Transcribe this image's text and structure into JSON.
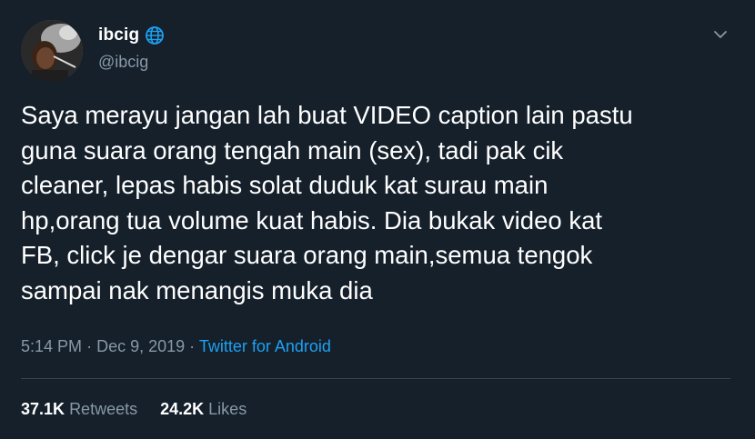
{
  "user": {
    "display_name": "ibcig",
    "handle": "@ibcig",
    "badge_icon": "globe-icon"
  },
  "tweet": {
    "text": "Saya merayu jangan lah buat VIDEO caption lain pastu\nguna suara orang tengah main (sex), tadi pak cik\ncleaner, lepas habis solat duduk kat surau main\nhp,orang tua volume kuat habis. Dia bukak video kat\nFB, click je dengar suara orang main,semua tengok\nsampai nak menangis muka dia",
    "time": "5:14 PM",
    "date": "Dec 9, 2019",
    "separator": "·",
    "source": "Twitter for Android"
  },
  "stats": {
    "retweets_count": "37.1K",
    "retweets_label": "Retweets",
    "likes_count": "24.2K",
    "likes_label": "Likes"
  },
  "colors": {
    "background": "#15202b",
    "text": "#ffffff",
    "secondary_text": "#8899a6",
    "accent": "#1da1f2",
    "divider": "#38444d"
  }
}
